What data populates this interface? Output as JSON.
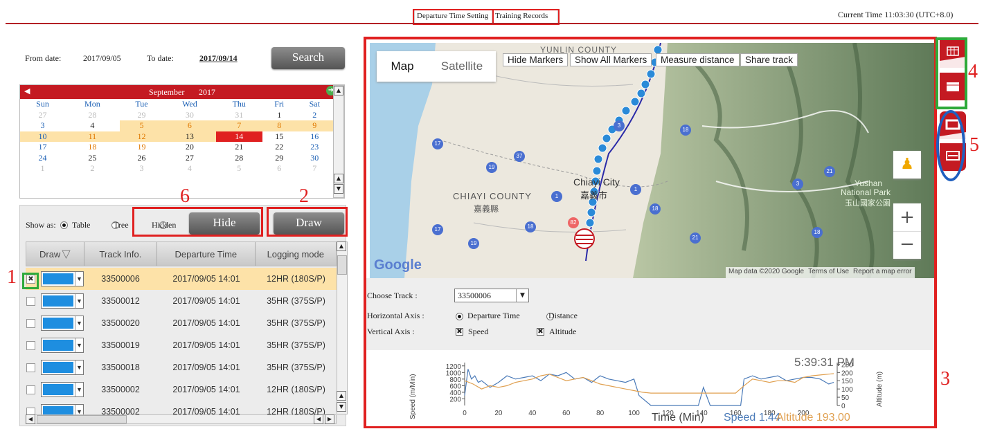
{
  "header": {
    "tabs": [
      "Departure Time Setting",
      "Training Records"
    ],
    "current_time": "Current Time 11:03:30 (UTC+8.0)"
  },
  "search": {
    "from_label": "From date:",
    "from_value": "2017/09/05",
    "to_label": "To date:",
    "to_value": "2017/09/14",
    "button": "Search"
  },
  "calendar": {
    "month": "September",
    "year": "2017",
    "weekdays": [
      "Sun",
      "Mon",
      "Tue",
      "Wed",
      "Thu",
      "Fri",
      "Sat"
    ],
    "weeks": [
      [
        "27",
        "28",
        "29",
        "30",
        "31",
        "1",
        "2"
      ],
      [
        "3",
        "4",
        "5",
        "6",
        "7",
        "8",
        "9"
      ],
      [
        "10",
        "11",
        "12",
        "13",
        "14",
        "15",
        "16"
      ],
      [
        "17",
        "18",
        "19",
        "20",
        "21",
        "22",
        "23"
      ],
      [
        "24",
        "25",
        "26",
        "27",
        "28",
        "29",
        "30"
      ],
      [
        "1",
        "2",
        "3",
        "4",
        "5",
        "6",
        "7"
      ]
    ],
    "prev_icon": "arrow-left-icon",
    "next_icon": "arrow-right-icon"
  },
  "options": {
    "show_as_label": "Show as:",
    "table_label": "Table",
    "tree_label": "Tree",
    "hidden_label": "Hidden",
    "hide_button": "Hide",
    "draw_button": "Draw"
  },
  "grid": {
    "columns": [
      "Draw",
      "Track Info.",
      "Departure Time",
      "Logging mode"
    ],
    "rows": [
      {
        "track": "33500006",
        "time": "2017/09/05 14:01",
        "mode": "12HR (180S/P)",
        "checked": true
      },
      {
        "track": "33500012",
        "time": "2017/09/05 14:01",
        "mode": "35HR (375S/P)",
        "checked": false
      },
      {
        "track": "33500020",
        "time": "2017/09/05 14:01",
        "mode": "35HR (375S/P)",
        "checked": false
      },
      {
        "track": "33500019",
        "time": "2017/09/05 14:01",
        "mode": "35HR (375S/P)",
        "checked": false
      },
      {
        "track": "33500018",
        "time": "2017/09/05 14:01",
        "mode": "35HR (375S/P)",
        "checked": false
      },
      {
        "track": "33500002",
        "time": "2017/09/05 14:01",
        "mode": "12HR (180S/P)",
        "checked": false
      },
      {
        "track": "33500002",
        "time": "2017/09/05 14:01",
        "mode": "12HR (180S/P)",
        "checked": false
      }
    ],
    "swatch_color": "#1e8ee0"
  },
  "map": {
    "type_map": "Map",
    "type_satellite": "Satellite",
    "buttons": [
      "Hide Markers",
      "Show All Markers",
      "Measure distance",
      "Share track"
    ],
    "labels": {
      "county_top": "YUNLIN COUNTY",
      "chiayi_county": "CHIAYI COUNTY",
      "chiayi_county_zh": "嘉義縣",
      "chiayi_city": "Chiayi City",
      "chiayi_city_zh": "嘉義市",
      "yushan": "Yushan",
      "national_park": "National Park",
      "yushan_zh": "玉山國家公園"
    },
    "road_numbers": [
      "17",
      "19",
      "37",
      "3",
      "18",
      "82",
      "17",
      "19",
      "1",
      "18",
      "18",
      "21",
      "21",
      "3",
      "1",
      "18"
    ],
    "google": "Google",
    "footer": [
      "Map data ©2020 Google",
      "Terms of Use",
      "Report a map error"
    ],
    "zoom_in": "+",
    "zoom_out": "−",
    "pegman_icon": "pegman-icon"
  },
  "chart_controls": {
    "choose_track_label": "Choose Track :",
    "choose_track_value": "33500006",
    "horizontal_axis_label": "Horizontal Axis :",
    "departure_time": "Departure Time",
    "distance": "Distance",
    "vertical_axis_label": "Vertical Axis :",
    "speed": "Speed",
    "altitude": "Altitude"
  },
  "chart_data": {
    "type": "line",
    "time_readout": "5:39:31 PM",
    "xlabel": "Time (Min)",
    "ylabel_left": "Speed (m/Min)",
    "ylabel_right": "Altitude (m)",
    "x_ticks": [
      "0",
      "20",
      "40",
      "60",
      "80",
      "100",
      "120",
      "140",
      "160",
      "180",
      "200"
    ],
    "y_left_ticks": [
      "200",
      "400",
      "600",
      "800",
      "1000",
      "1200"
    ],
    "y_right_ticks": [
      "0",
      "50",
      "100",
      "150",
      "200",
      "250"
    ],
    "xlim": [
      0,
      220
    ],
    "ylim_left": [
      0,
      1300
    ],
    "ylim_right": [
      0,
      260
    ],
    "speed_readout": "Speed 1.44",
    "altitude_readout": "Altitude 193.00",
    "series": [
      {
        "name": "Speed",
        "color": "#4a7ab8",
        "x": [
          0,
          2,
          4,
          6,
          8,
          10,
          15,
          20,
          25,
          30,
          35,
          40,
          45,
          50,
          55,
          60,
          65,
          70,
          75,
          80,
          85,
          90,
          95,
          100,
          103,
          110,
          120,
          130,
          138,
          141,
          145,
          150,
          155,
          160,
          163,
          165,
          170,
          175,
          180,
          185,
          190,
          195,
          200,
          205,
          210,
          215,
          218
        ],
        "y": [
          300,
          1100,
          800,
          900,
          700,
          750,
          550,
          700,
          900,
          800,
          850,
          900,
          750,
          950,
          900,
          1000,
          800,
          850,
          700,
          900,
          800,
          750,
          700,
          800,
          300,
          0,
          0,
          0,
          0,
          550,
          0,
          0,
          0,
          0,
          0,
          800,
          900,
          800,
          850,
          900,
          750,
          800,
          850,
          850,
          800,
          650,
          700
        ]
      },
      {
        "name": "Altitude",
        "color": "#e0a050",
        "x": [
          0,
          5,
          10,
          15,
          20,
          25,
          30,
          35,
          40,
          45,
          50,
          55,
          60,
          65,
          70,
          75,
          80,
          85,
          90,
          95,
          100,
          105,
          110,
          120,
          130,
          140,
          150,
          160,
          165,
          170,
          175,
          180,
          185,
          190,
          195,
          200,
          205,
          210,
          215,
          218
        ],
        "y": [
          150,
          130,
          100,
          120,
          110,
          120,
          140,
          150,
          160,
          180,
          190,
          170,
          150,
          160,
          170,
          150,
          130,
          120,
          110,
          100,
          90,
          80,
          75,
          75,
          75,
          75,
          75,
          75,
          120,
          160,
          150,
          140,
          150,
          150,
          140,
          170,
          180,
          185,
          190,
          193
        ]
      }
    ]
  },
  "annotations": [
    "1",
    "2",
    "3",
    "4",
    "5",
    "6"
  ]
}
